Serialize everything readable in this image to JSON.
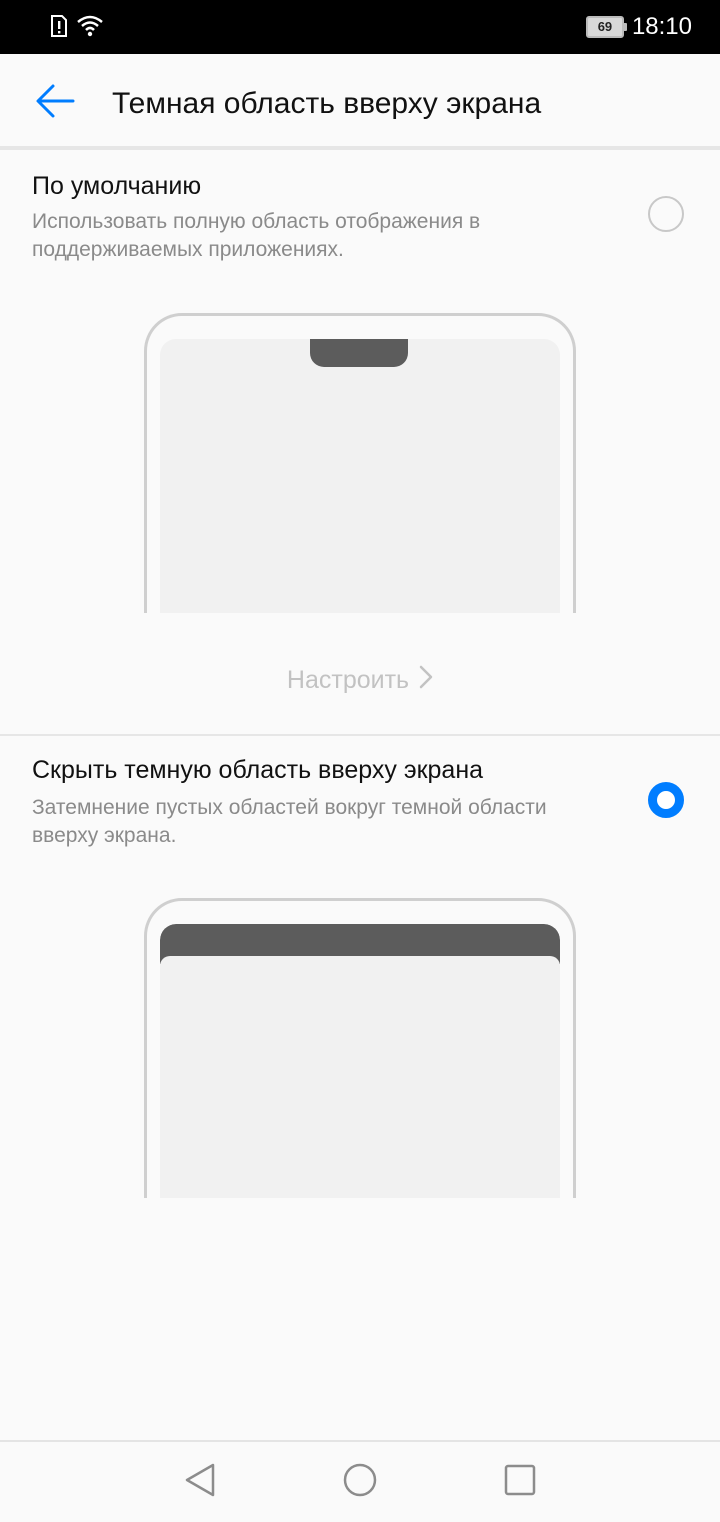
{
  "status_bar": {
    "time": "18:10",
    "battery_level": "69",
    "icons": [
      "alert-sim-icon",
      "wifi-icon",
      "battery-icon"
    ]
  },
  "app_bar": {
    "title": "Темная область вверху экрана",
    "back_icon": "arrow-left-icon"
  },
  "options": [
    {
      "title": "По умолчанию",
      "description": "Использовать полную область отображения в поддерживаемых приложениях.",
      "selected": false
    },
    {
      "title": "Скрыть темную область вверху экрана",
      "description": "Затемнение пустых областей вокруг темной области вверху экрана.",
      "selected": true
    }
  ],
  "customize": {
    "label": "Настроить",
    "icon": "chevron-right-icon"
  },
  "colors": {
    "accent": "#007dff",
    "disabled_text": "#c2c2c2",
    "secondary_text": "#8a8a8a",
    "mockup_dark": "#5c5c5c",
    "mockup_screen": "#f1f1f1"
  },
  "nav_bar": {
    "buttons": [
      "back-triangle-icon",
      "home-circle-icon",
      "recents-square-icon"
    ]
  }
}
